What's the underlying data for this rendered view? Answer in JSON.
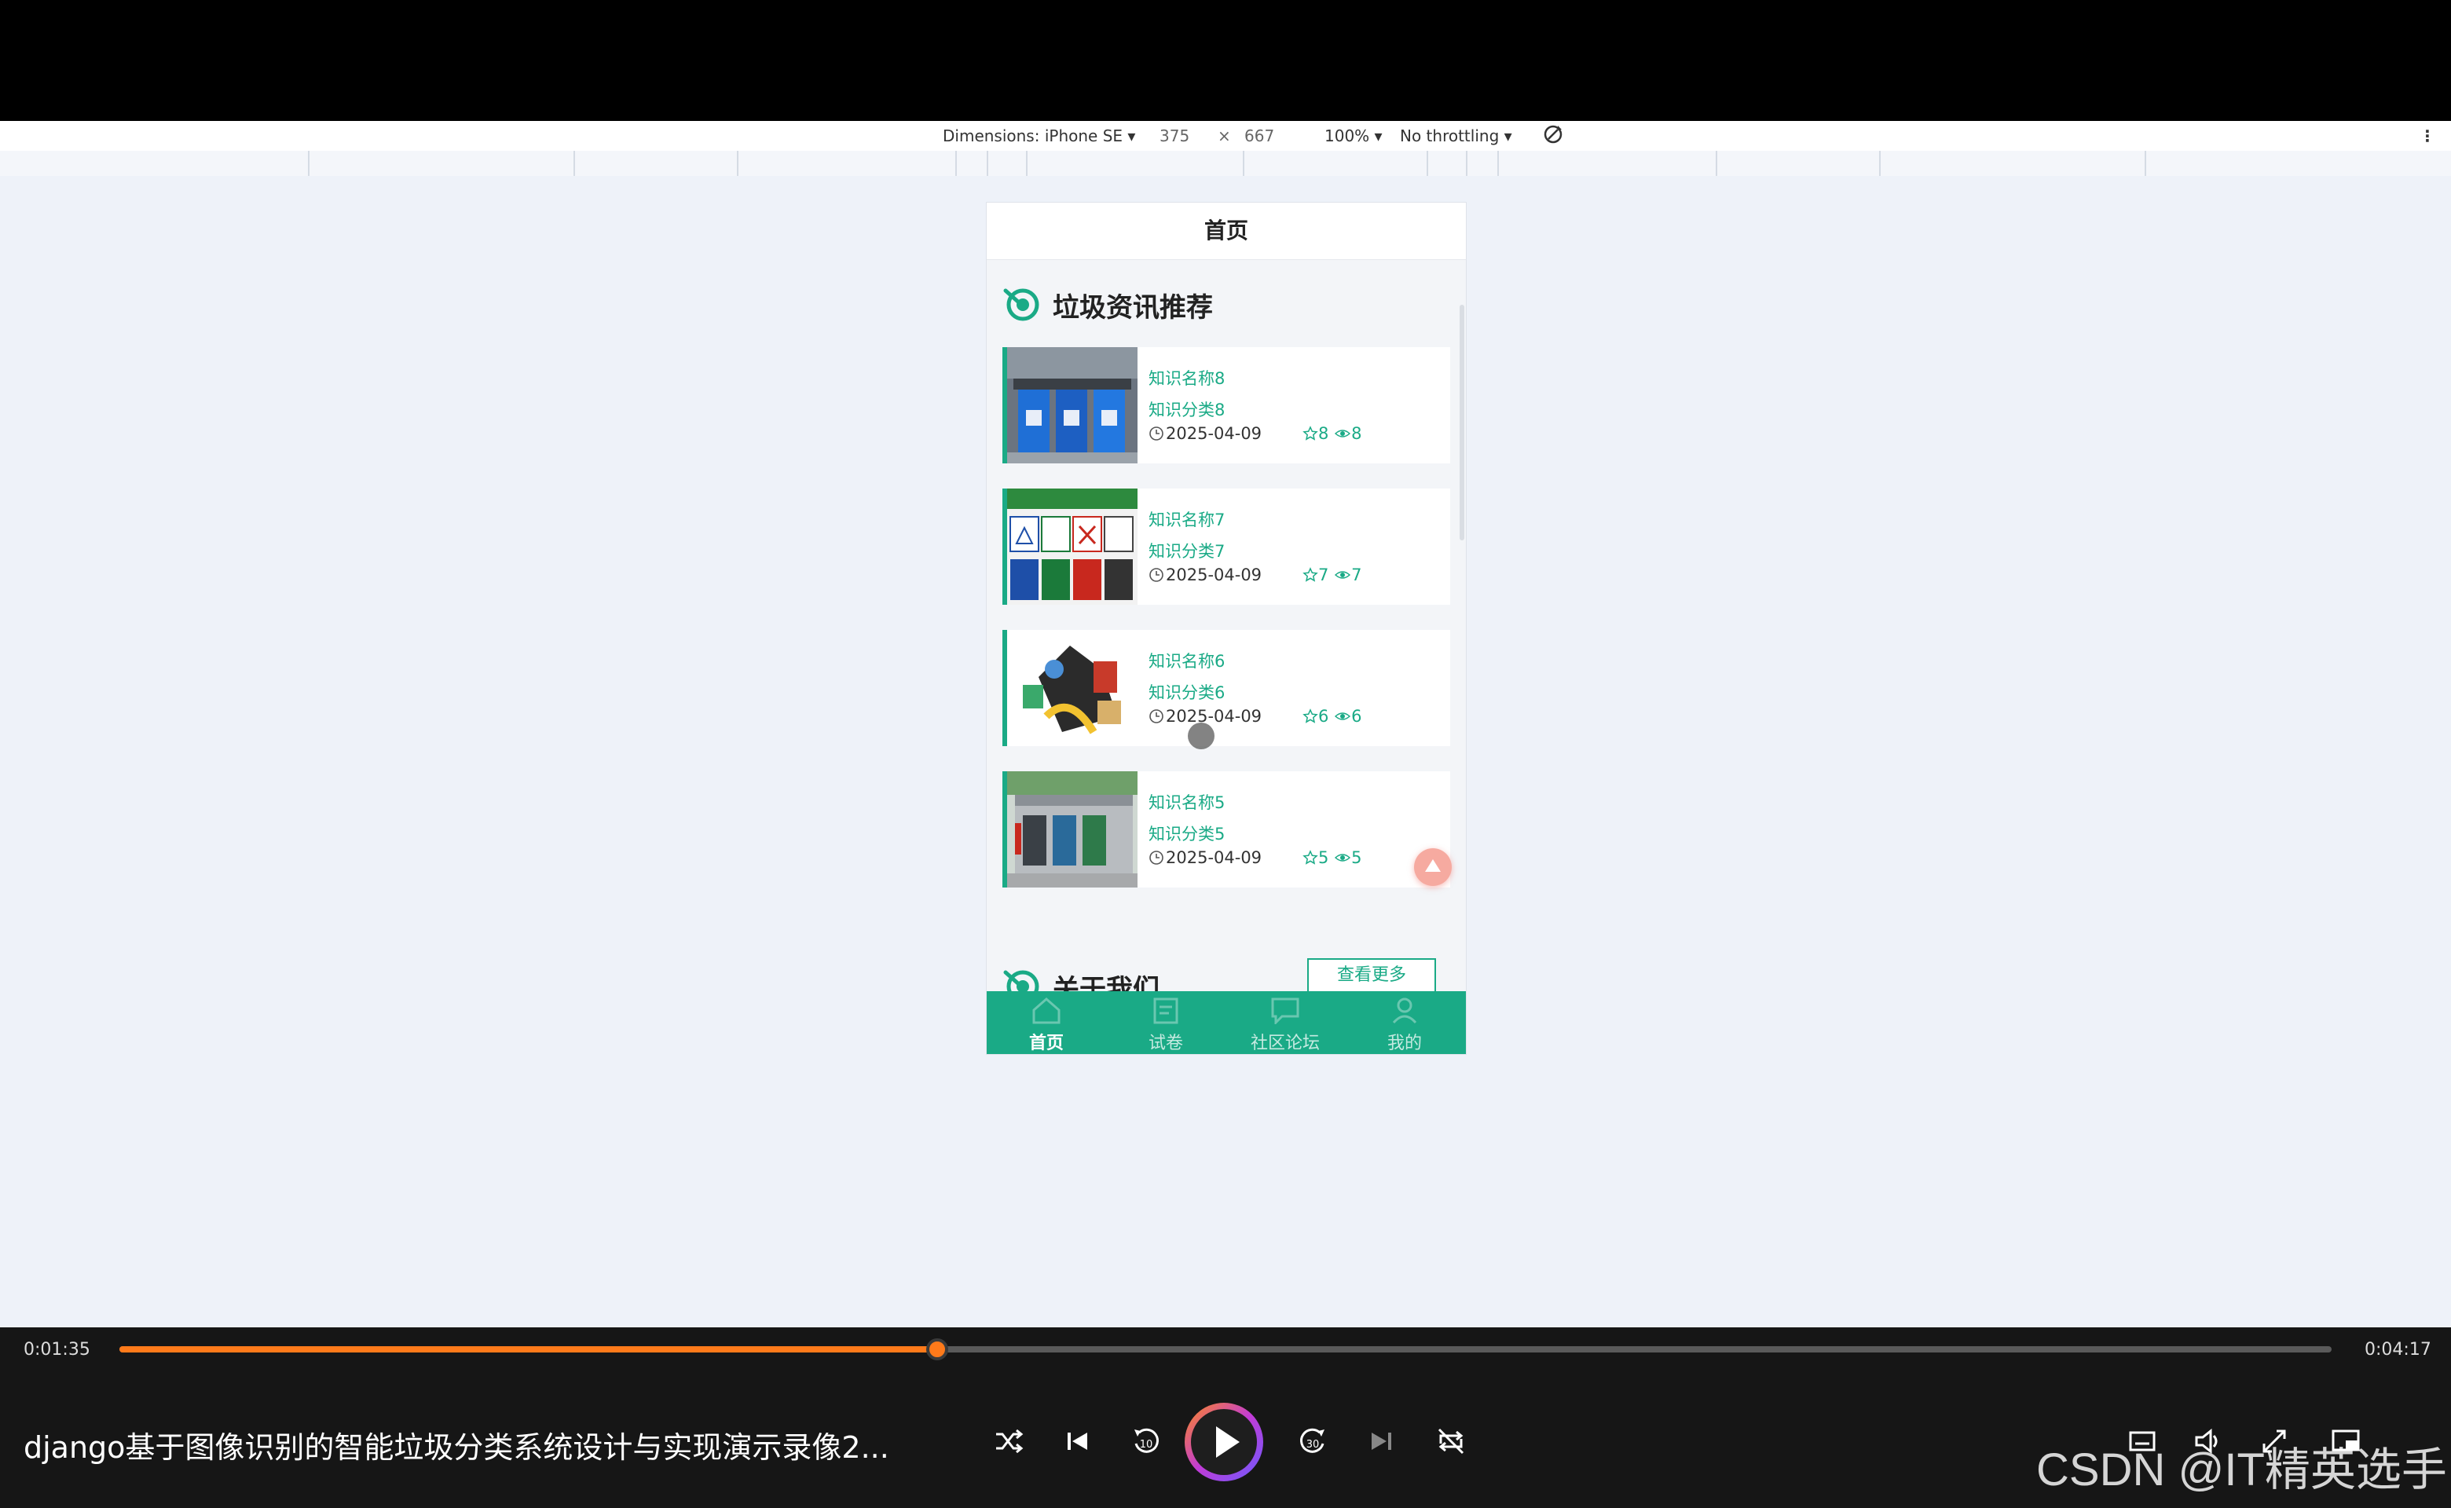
{
  "devtools": {
    "dimensions_label": "Dimensions: iPhone SE ▾",
    "width": "375",
    "times": "×",
    "height": "667",
    "zoom": "100% ▾",
    "throttling": "No throttling ▾",
    "more": "⋮"
  },
  "app": {
    "header_title": "首页",
    "section_title": "垃圾资讯推荐",
    "about_title": "关于我们",
    "view_more": "查看更多",
    "items": [
      {
        "name": "知识名称8",
        "category": "知识分类8",
        "date": "2025-04-09",
        "favorites": "8",
        "views": "8"
      },
      {
        "name": "知识名称7",
        "category": "知识分类7",
        "date": "2025-04-09",
        "favorites": "7",
        "views": "7"
      },
      {
        "name": "知识名称6",
        "category": "知识分类6",
        "date": "2025-04-09",
        "favorites": "6",
        "views": "6"
      },
      {
        "name": "知识名称5",
        "category": "知识分类5",
        "date": "2025-04-09",
        "favorites": "5",
        "views": "5"
      }
    ],
    "tabs": [
      {
        "label": "首页",
        "icon": "home-icon",
        "active": true
      },
      {
        "label": "试卷",
        "icon": "exam-icon",
        "active": false
      },
      {
        "label": "社区论坛",
        "icon": "forum-icon",
        "active": false
      },
      {
        "label": "我的",
        "icon": "user-icon",
        "active": false
      }
    ],
    "accent_color": "#1aaa86"
  },
  "player": {
    "current_time": "0:01:35",
    "total_time": "0:04:17",
    "progress": 0.3696,
    "title": "django基于图像识别的智能垃圾分类系统设计与实现演示录像2...",
    "skip_back": "10",
    "skip_forward": "30",
    "accent_color": "#ff7a1a"
  },
  "watermark": "CSDN @IT精英选手"
}
